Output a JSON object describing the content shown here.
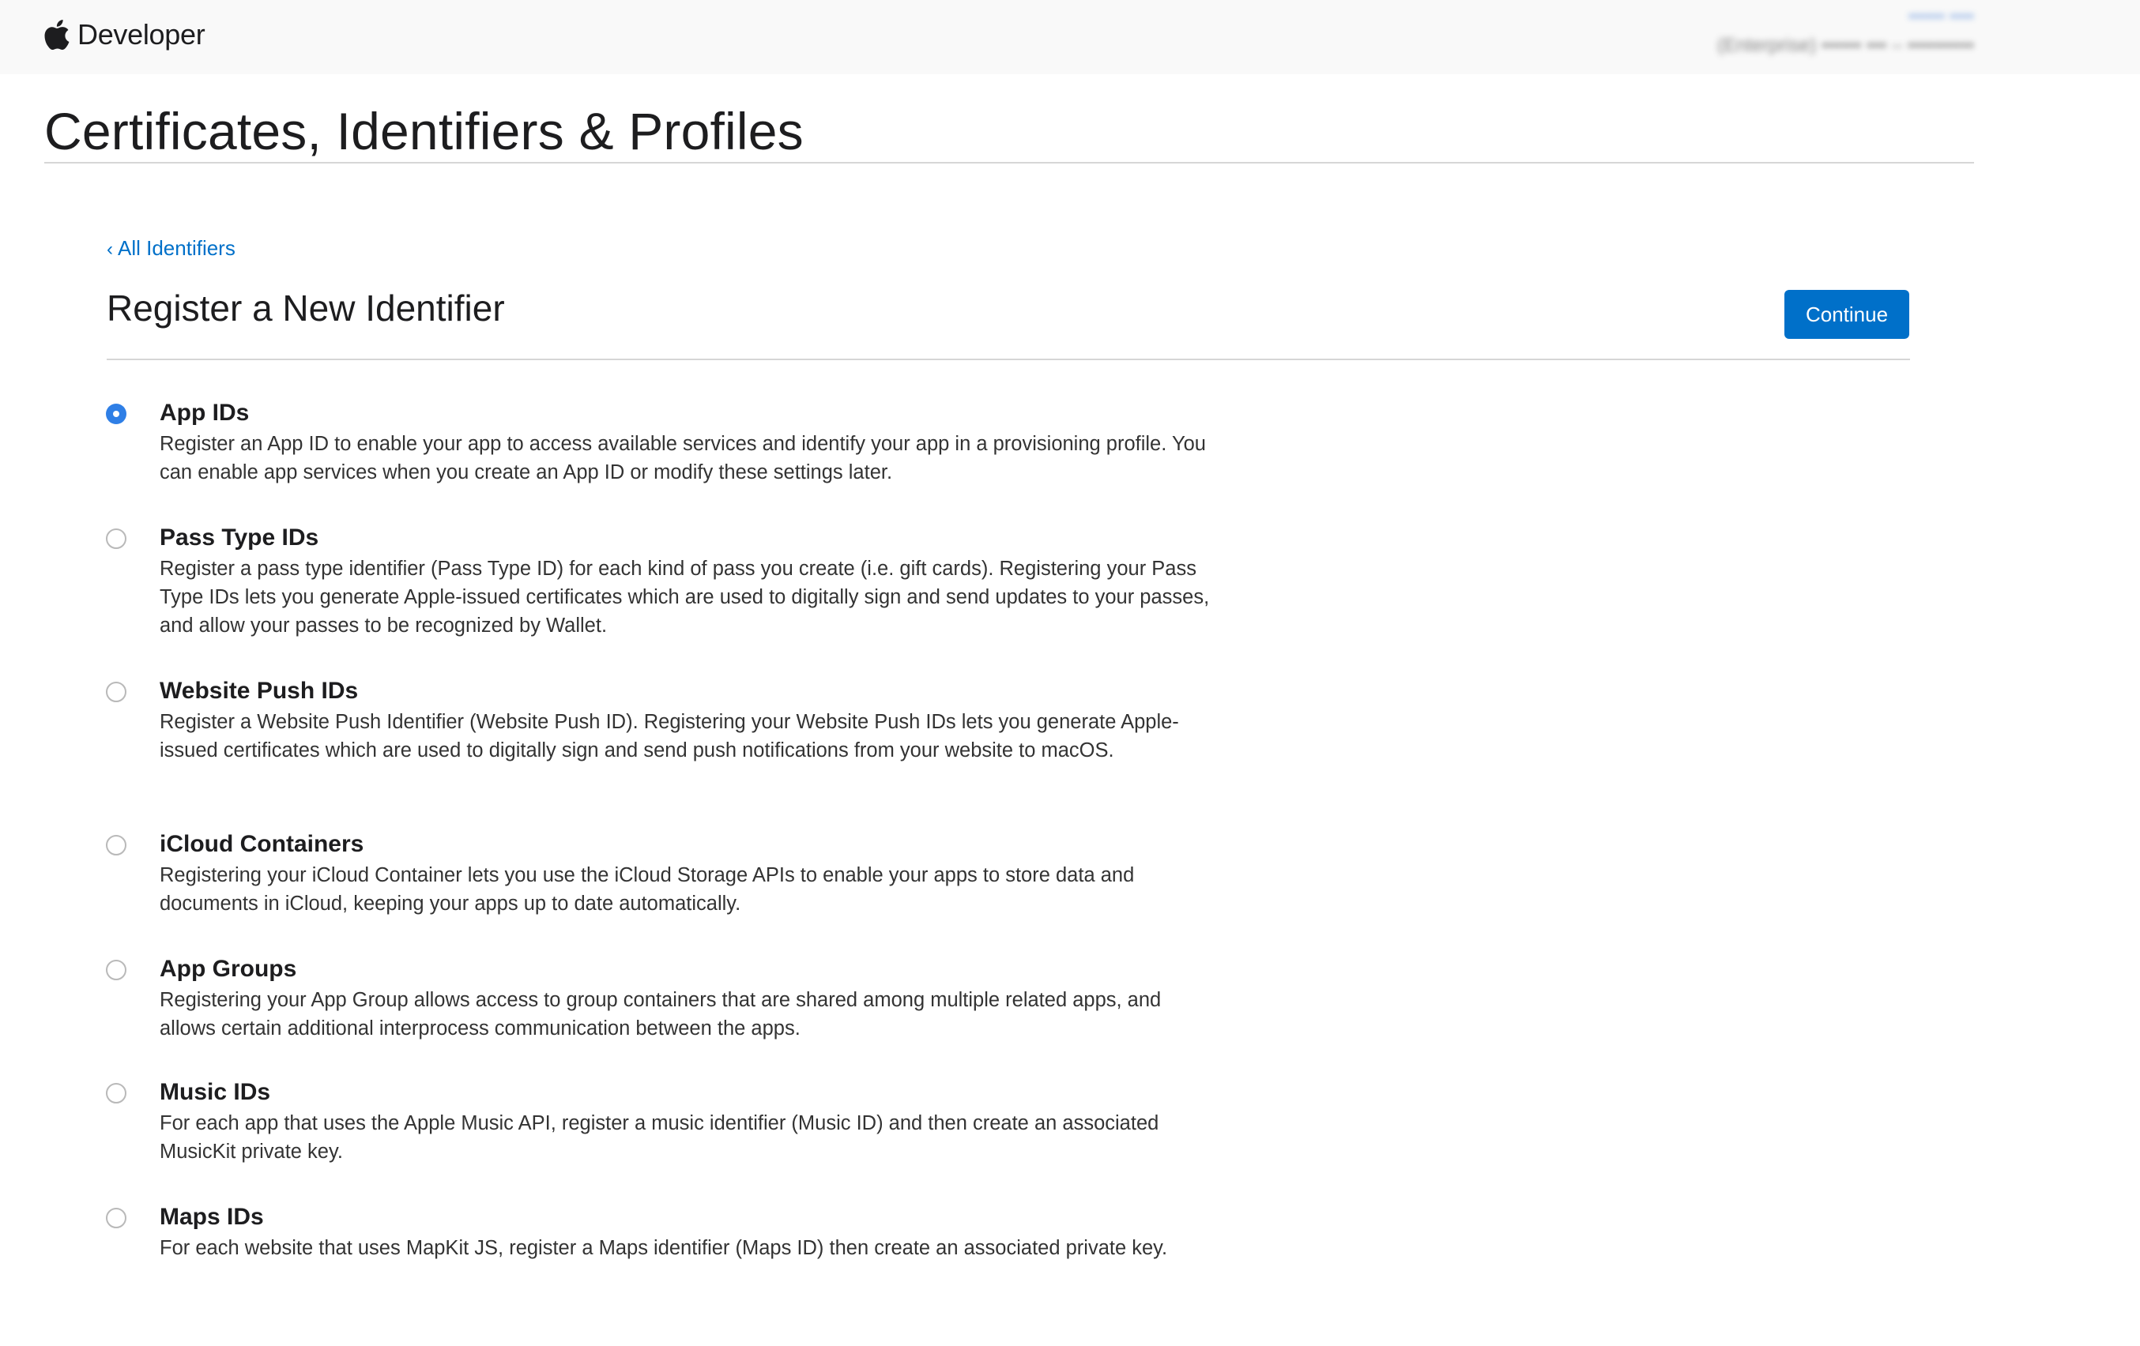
{
  "header": {
    "brand": "Developer",
    "account_name": "•••••• ••••",
    "account_team": "(Enterprise) •••••• ••• – ••••••••••"
  },
  "page": {
    "title": "Certificates, Identifiers & Profiles"
  },
  "register": {
    "back_link": "All Identifiers",
    "title": "Register a New Identifier",
    "continue_label": "Continue"
  },
  "options": [
    {
      "title": "App IDs",
      "description": "Register an App ID to enable your app to access available services and identify your app in a provisioning profile. You can enable app services when you create an App ID or modify these settings later.",
      "selected": true
    },
    {
      "title": "Pass Type IDs",
      "description": "Register a pass type identifier (Pass Type ID) for each kind of pass you create (i.e. gift cards). Registering your Pass Type IDs lets you generate Apple-issued certificates which are used to digitally sign and send updates to your passes, and allow your passes to be recognized by Wallet.",
      "selected": false
    },
    {
      "title": "Website Push IDs",
      "description": "Register a Website Push Identifier (Website Push ID). Registering your Website Push IDs lets you generate Apple-issued certificates which are used to digitally sign and send push notifications from your website to macOS.",
      "selected": false
    },
    {
      "title": "iCloud Containers",
      "description": "Registering your iCloud Container lets you use the iCloud Storage APIs to enable your apps to store data and documents in iCloud, keeping your apps up to date automatically.",
      "selected": false
    },
    {
      "title": "App Groups",
      "description": "Registering your App Group allows access to group containers that are shared among multiple related apps, and allows certain additional interprocess communication between the apps.",
      "selected": false
    },
    {
      "title": "Music IDs",
      "description": "For each app that uses the Apple Music API, register a music identifier (Music ID) and then create an associated MusicKit private key.",
      "selected": false
    },
    {
      "title": "Maps IDs",
      "description": "For each website that uses MapKit JS, register a Maps identifier (Maps ID) then create an associated private key.",
      "selected": false
    }
  ],
  "colors": {
    "accent": "#0070c9",
    "radio_selected": "#2f7fe6",
    "topbar_bg": "#f9f9f9"
  }
}
